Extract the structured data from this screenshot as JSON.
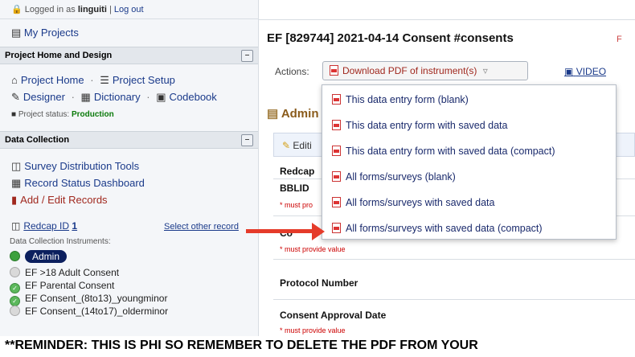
{
  "sidebar": {
    "login": {
      "prefix": "Logged in as",
      "user": "linguiti",
      "sep": "|",
      "logout": "Log out"
    },
    "my_projects": "My Projects",
    "section_project": {
      "title": "Project Home and Design",
      "collapse": "–"
    },
    "project_home": "Project Home",
    "dot_sep": "·",
    "project_setup": "Project Setup",
    "designer": "Designer",
    "dictionary": "Dictionary",
    "codebook": "Codebook",
    "status_label": "Project status:",
    "status_value": "Production",
    "section_data": {
      "title": "Data Collection",
      "collapse": "–"
    },
    "survey_tools": "Survey Distribution Tools",
    "record_status": "Record Status Dashboard",
    "add_edit": "Add / Edit Records",
    "record_id_label": "Redcap ID",
    "record_id_value": "1",
    "select_other": "Select other record",
    "instruments_label": "Data Collection Instruments:",
    "instruments": [
      {
        "label": "Admin",
        "status": "green"
      },
      {
        "label": "EF >18 Adult Consent",
        "status": "gray"
      },
      {
        "label": "EF Parental Consent",
        "status": "check"
      },
      {
        "label": "EF Consent_(8to13)_youngminor",
        "status": "check"
      },
      {
        "label": "EF Consent_(14to17)_olderminor",
        "status": "gray"
      }
    ]
  },
  "main": {
    "title": "EF [829744] 2021-04-14 Consent #consents",
    "title_badge": "F",
    "actions_label": "Actions:",
    "download_button": "Download PDF of instrument(s)",
    "video_link": "VIDEO",
    "admin_heading": "Admin",
    "edit_label": "Editi",
    "fields": [
      {
        "label": "Redcap",
        "must": ""
      },
      {
        "label": "BBLID",
        "must": "* must pro"
      },
      {
        "label": "Co",
        "must": "* must provide value"
      },
      {
        "label": "Protocol Number",
        "must": ""
      },
      {
        "label": "Consent Approval Date",
        "must": "* must provide value"
      }
    ]
  },
  "menu": {
    "items": [
      "This data entry form (blank)",
      "This data entry form with saved data",
      "This data entry form with saved data (compact)",
      "All forms/surveys (blank)",
      "All forms/surveys with saved data",
      "All forms/surveys with saved data (compact)"
    ]
  },
  "annotation": {
    "reminder": "**REMINDER: THIS IS PHI SO REMEMBER TO DELETE THE PDF FROM YOUR"
  },
  "colors": {
    "accent": "#1a3a8a",
    "status_green": "#0a7a0a",
    "arrow_red": "#e53b2a",
    "required_red": "#c00"
  }
}
